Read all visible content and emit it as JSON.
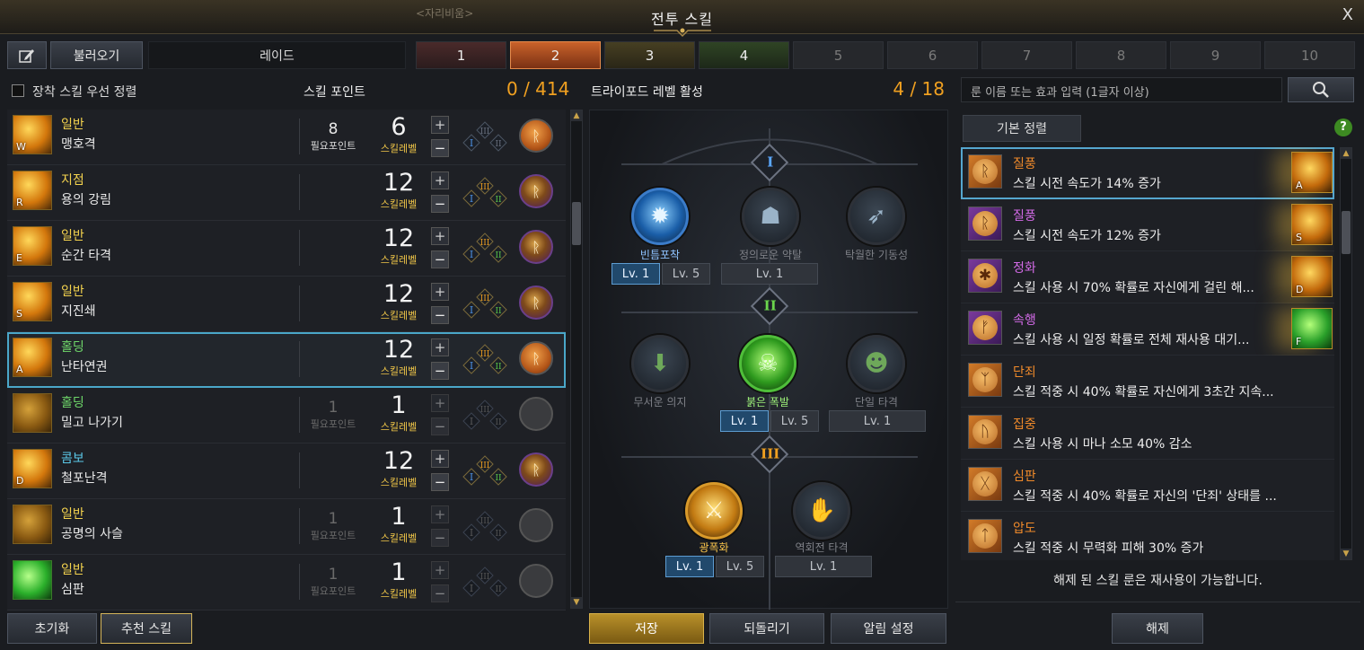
{
  "window": {
    "title": "전투 스킬",
    "faded_text": "<자리비움>",
    "close": "X"
  },
  "toolbar": {
    "load_button": "불러오기",
    "preset_name": "레이드"
  },
  "presets": [
    "1",
    "2",
    "3",
    "4",
    "5",
    "6",
    "7",
    "8",
    "9",
    "10"
  ],
  "active_preset": "2",
  "left": {
    "sort_checkbox_label": "장착 스킬 우선 정렬",
    "skill_point_label": "스킬 포인트",
    "skill_point_value": "0 / 414",
    "need_label": "필요포인트",
    "level_label": "스킬레벨",
    "reset_button": "초기화",
    "recommend_button": "추천 스킬",
    "skills": [
      {
        "category": "일반",
        "name": "맹호격",
        "key": "W",
        "points": "8",
        "level": "6",
        "color": "#f3d24e"
      },
      {
        "category": "지점",
        "name": "용의 강림",
        "key": "R",
        "points": "",
        "level": "12",
        "color": "#f3d24e"
      },
      {
        "category": "일반",
        "name": "순간 타격",
        "key": "E",
        "points": "",
        "level": "12",
        "color": "#f3d24e"
      },
      {
        "category": "일반",
        "name": "지진쇄",
        "key": "S",
        "points": "",
        "level": "12",
        "color": "#f3d24e"
      },
      {
        "category": "홀딩",
        "name": "난타연권",
        "key": "A",
        "points": "",
        "level": "12",
        "color": "#6fd86a"
      },
      {
        "category": "홀딩",
        "name": "밀고 나가기",
        "key": "",
        "points": "1",
        "level": "1",
        "color": "#6fd86a"
      },
      {
        "category": "콤보",
        "name": "철포난격",
        "key": "D",
        "points": "",
        "level": "12",
        "color": "#5bc8e8"
      },
      {
        "category": "일반",
        "name": "공명의 사슬",
        "key": "",
        "points": "1",
        "level": "1",
        "color": "#f3d24e"
      },
      {
        "category": "일반",
        "name": "심판",
        "key": "",
        "points": "1",
        "level": "1",
        "color": "#f3d24e"
      }
    ]
  },
  "tripod": {
    "header": "트라이포드 레벨 활성",
    "value": "4 / 18",
    "tiers": [
      "I",
      "II",
      "III"
    ],
    "nodes": [
      {
        "name": "빈틈포착"
      },
      {
        "name": "정의로운 약탈"
      },
      {
        "name": "탁월한 기동성"
      },
      {
        "name": "무서운 의지"
      },
      {
        "name": "붉은 폭발"
      },
      {
        "name": "단일 타격"
      },
      {
        "name": "광폭화"
      },
      {
        "name": "역회전 타격"
      }
    ],
    "lv1": "Lv. 1",
    "lv5": "Lv. 5",
    "save_button": "저장",
    "revert_button": "되돌리기",
    "alert_button": "알림 설정"
  },
  "runes": {
    "search_placeholder": "룬 이름 또는 효과 입력 (1글자 이상)",
    "sort_button": "기본 정렬",
    "help": "?",
    "items": [
      {
        "name": "질풍",
        "desc": "스킬 시전 속도가 14% 증가",
        "color": "#f08a2a",
        "key": "A"
      },
      {
        "name": "질풍",
        "desc": "스킬 시전 속도가 12% 증가",
        "color": "#d46be8",
        "key": "S"
      },
      {
        "name": "정화",
        "desc": "스킬 사용 시 70% 확률로 자신에게 걸린 해...",
        "color": "#d46be8",
        "key": "D"
      },
      {
        "name": "속행",
        "desc": "스킬 사용 시 일정 확률로 전체 재사용 대기...",
        "color": "#d46be8",
        "key": "F"
      },
      {
        "name": "단죄",
        "desc": "스킬 적중 시 40% 확률로 자신에게 3초간 지속...",
        "color": "#f08a2a",
        "key": ""
      },
      {
        "name": "집중",
        "desc": "스킬 사용 시 마나 소모 40% 감소",
        "color": "#f08a2a",
        "key": ""
      },
      {
        "name": "심판",
        "desc": "스킬 적중 시 40% 확률로 자신의 '단죄' 상태를 ...",
        "color": "#f08a2a",
        "key": ""
      },
      {
        "name": "압도",
        "desc": "스킬 적중 시 무력화 피해 30% 증가",
        "color": "#f08a2a",
        "key": ""
      }
    ],
    "notice": "해제 된 스킬 룬은 재사용이 가능합니다.",
    "release_button": "해제"
  }
}
